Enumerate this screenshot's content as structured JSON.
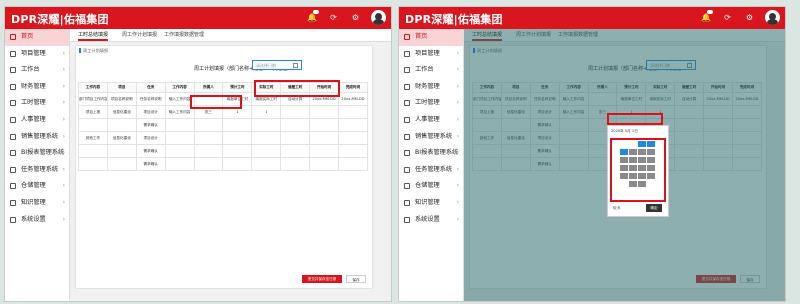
{
  "app": {
    "logo": "DPR深耀|佑福集团"
  },
  "sidebar": {
    "items": [
      {
        "label": "首页",
        "icon": "home-icon",
        "active": true
      },
      {
        "label": "项目管理",
        "icon": "project-icon"
      },
      {
        "label": "工作台",
        "icon": "desk-icon"
      },
      {
        "label": "财务管理",
        "icon": "finance-icon"
      },
      {
        "label": "工时管理",
        "icon": "clock-icon"
      },
      {
        "label": "人事管理",
        "icon": "person-icon"
      },
      {
        "label": "销售管理系统",
        "icon": "sales-icon"
      },
      {
        "label": "BI报表管理系统",
        "icon": "report-icon"
      },
      {
        "label": "任务管理系统",
        "icon": "task-icon"
      },
      {
        "label": "仓储管理",
        "icon": "storage-icon"
      },
      {
        "label": "知识管理",
        "icon": "knowledge-icon"
      },
      {
        "label": "系统设置",
        "icon": "settings-icon"
      }
    ]
  },
  "tabs": [
    {
      "label": "工时总结填报",
      "active": true
    },
    {
      "label": "周工作计划填报"
    },
    {
      "label": "工作填报数据管理"
    }
  ],
  "content": {
    "section_title": "周工计划填报",
    "table_title": "周工计划填报（部门名称+姓名+人员姓名）",
    "date_placeholder": "请选择日期"
  },
  "table": {
    "headers": [
      "工作内容",
      "项目",
      "任务",
      "工作内容",
      "所属人",
      "预计工时",
      "实际工时",
      "偏差工时",
      "开始时间",
      "完成时间"
    ],
    "rows": [
      [
        "部门项目工作内容",
        "项目名称说明",
        "任务名称说明",
        "输入工作内容",
        "",
        "填报单位工时",
        "填报实际工时",
        "自动计算",
        "20xx-MM-DD",
        "20xx-MM-DD"
      ],
      [
        "项目上报",
        "信息化建设",
        "项目设计",
        "输入工作内容",
        "张三",
        "1",
        "1",
        "",
        "",
        ""
      ],
      [
        "",
        "",
        "需求确认",
        "",
        "",
        "",
        "",
        "",
        "",
        ""
      ],
      [
        "其他工作",
        "信息化建设",
        "项目设计",
        "",
        "",
        "",
        "",
        "",
        "",
        ""
      ],
      [
        "",
        "",
        "需求确认",
        "",
        "",
        "",
        "",
        "",
        "",
        ""
      ],
      [
        "",
        "",
        "需求确认",
        "",
        "",
        "",
        "",
        "",
        "",
        ""
      ]
    ]
  },
  "buttons": {
    "submit": "提交并保存至日报",
    "save": "保存"
  },
  "picker": {
    "header": "2020年  5月  1日",
    "cancel": "取消",
    "confirm": "确定"
  },
  "colors": {
    "brand": "#d9161e",
    "highlight": "#e01018",
    "picker_selected": "#1e88e5"
  }
}
